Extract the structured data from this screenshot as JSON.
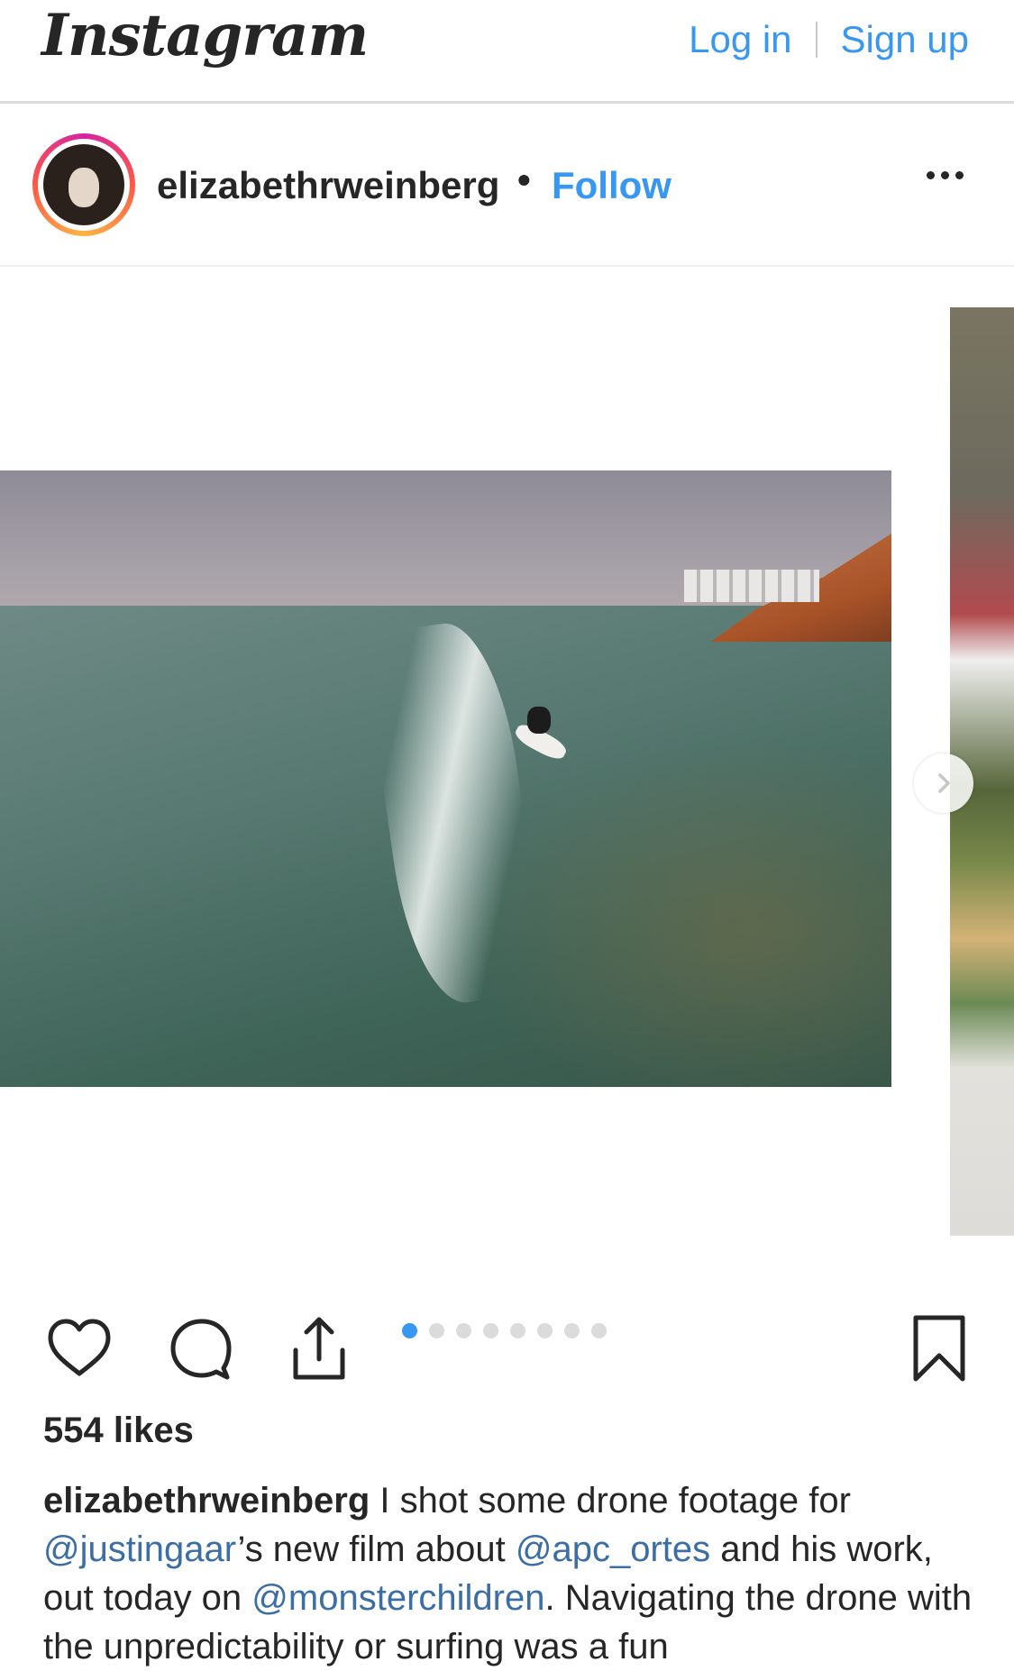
{
  "header": {
    "logo_text": "Instagram",
    "login_label": "Log in",
    "signup_label": "Sign up"
  },
  "post": {
    "username": "elizabethrweinberg",
    "separator": "•",
    "follow_label": "Follow",
    "carousel": {
      "total": 8,
      "active_index": 0
    },
    "likes_text": "554 likes",
    "caption": {
      "username": "elizabethrweinberg",
      "segments": [
        {
          "type": "text",
          "value": " I shot some drone footage for "
        },
        {
          "type": "mention",
          "value": "@justingaar"
        },
        {
          "type": "text",
          "value": "’s new film about "
        },
        {
          "type": "mention",
          "value": "@apc_ortes"
        },
        {
          "type": "text",
          "value": " and his work, out today on "
        },
        {
          "type": "mention",
          "value": "@monsterchildren"
        },
        {
          "type": "text",
          "value": ". Navigating the drone with the unpredictability or surfing was a fun"
        }
      ]
    }
  },
  "icons": {
    "more": "more-horizontal-icon",
    "like": "heart-icon",
    "comment": "comment-icon",
    "share": "share-icon",
    "save": "bookmark-icon",
    "next": "chevron-right-icon"
  },
  "colors": {
    "link_blue": "#3897f0",
    "mention_blue": "#3b6ea5",
    "text": "#262626",
    "divider": "#dbdbdb"
  }
}
